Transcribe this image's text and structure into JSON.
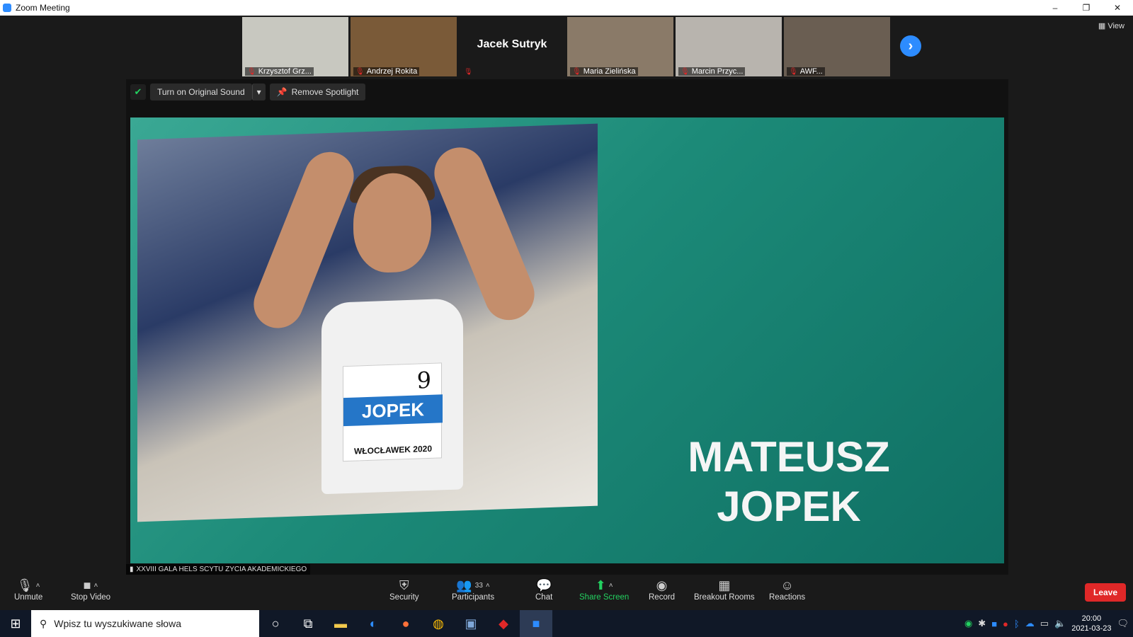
{
  "window": {
    "title": "Zoom Meeting",
    "minimize": "–",
    "restore": "❐",
    "close": "✕"
  },
  "thumbnails": [
    {
      "name": "Krzysztof Grz...",
      "bg": "#c8c8c0"
    },
    {
      "name": "Andrzej Rokita",
      "bg": "#7a5a38"
    },
    {
      "name": "",
      "big_name": "Jacek Sutryk",
      "bg": "#1a1a1a"
    },
    {
      "name": "Maria Zielińska",
      "bg": "#8a7a68"
    },
    {
      "name": "Marcin Przyc...",
      "bg": "#b8b4ae"
    },
    {
      "name": "AWF...",
      "bg": "#6a5e52"
    }
  ],
  "view_button": "View",
  "next_icon": "›",
  "spotlight": {
    "original_sound": "Turn on Original Sound",
    "remove_spotlight": "Remove Spotlight",
    "video_label": "XXVIII GALA HELS SCYTU ZYCIA AKADEMICKIEGO",
    "caption_line1": "MATEUSZ",
    "caption_line2": "JOPEK",
    "bib_number": "9",
    "bib_name": "JOPEK",
    "bib_city": "WŁOCŁAWEK 2020"
  },
  "toolbar": {
    "unmute": "Unmute",
    "stop_video": "Stop Video",
    "security": "Security",
    "participants": "Participants",
    "participants_count": "33",
    "chat": "Chat",
    "share_screen": "Share Screen",
    "record": "Record",
    "breakout_rooms": "Breakout Rooms",
    "reactions": "Reactions",
    "leave": "Leave"
  },
  "taskbar": {
    "search_placeholder": "Wpisz tu wyszukiwane słowa",
    "time": "20:00",
    "date": "2021-03-23"
  }
}
